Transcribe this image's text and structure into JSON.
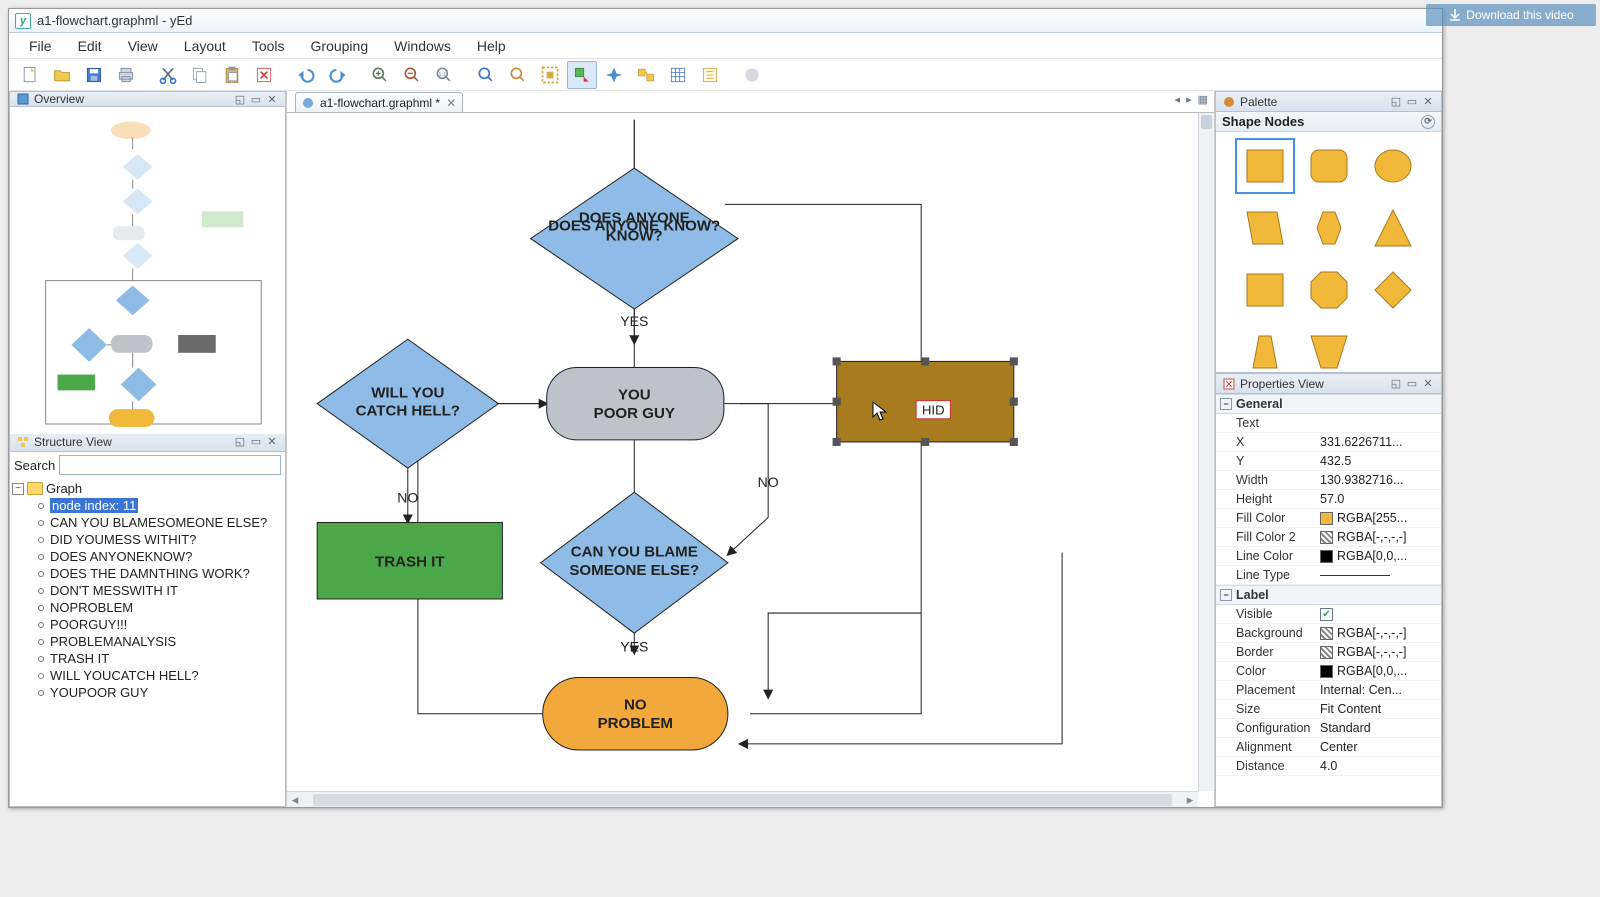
{
  "window": {
    "title": "a1-flowchart.graphml - yEd"
  },
  "download_label": "Download this video",
  "menus": [
    "File",
    "Edit",
    "View",
    "Layout",
    "Tools",
    "Grouping",
    "Windows",
    "Help"
  ],
  "toolbar_icons": [
    "new-file-icon",
    "open-file-icon",
    "save-icon",
    "print-icon",
    "cut-icon",
    "copy-icon",
    "paste-icon",
    "delete-icon",
    "undo-icon",
    "redo-icon",
    "zoom-in-icon",
    "zoom-out-icon",
    "fit-icon",
    "zoom-selection-icon",
    "zoom-area-icon",
    "fit-content-icon",
    "selection-mode-icon",
    "navigation-mode-icon",
    "magnifier-icon",
    "grid-icon",
    "snap-icon",
    "overview-icon"
  ],
  "panels": {
    "overview_title": "Overview",
    "structure_title": "Structure View",
    "palette_title": "Palette",
    "properties_title": "Properties View"
  },
  "doctab": {
    "label": "a1-flowchart.graphml *"
  },
  "flowchart": {
    "decision1": "DOES ANYONE KNOW?",
    "decision2_l1": "WILL YOU",
    "decision2_l2": "CATCH HELL?",
    "process_l1": "YOU",
    "process_l2": "POOR GUY",
    "decision3_l1": "CAN YOU BLAME",
    "decision3_l2": "SOMEONE ELSE?",
    "trash": "TRASH IT",
    "noproblem_l1": "NO",
    "noproblem_l2": "PROBLEM",
    "yes1": "YES",
    "yes2": "YES",
    "no1": "NO",
    "no2": "NO",
    "editing_text": "HID"
  },
  "structure": {
    "search_label": "Search",
    "root": "Graph",
    "selected": "node index: 11",
    "items": [
      "CAN YOU BLAMESOMEONE ELSE?",
      "DID YOUMESS WITHIT?",
      "DOES ANYONEKNOW?",
      "DOES THE DAMNTHING WORK?",
      "DON'T MESSWITH IT",
      "NOPROBLEM",
      "POORGUY!!!",
      "PROBLEMANALYSIS",
      "TRASH IT",
      "WILL YOUCATCH HELL?",
      "YOUPOOR GUY"
    ]
  },
  "palette": {
    "section": "Shape Nodes"
  },
  "properties": {
    "group_general": "General",
    "group_label": "Label",
    "rows": {
      "text_k": "Text",
      "text_v": "",
      "x_k": "X",
      "x_v": "331.6226711...",
      "y_k": "Y",
      "y_v": "432.5",
      "width_k": "Width",
      "width_v": "130.9382716...",
      "height_k": "Height",
      "height_v": "57.0",
      "fill_k": "Fill Color",
      "fill_v": "RGBA[255...",
      "fill2_k": "Fill Color 2",
      "fill2_v": "RGBA[-,-,-,-]",
      "linec_k": "Line Color",
      "linec_v": "RGBA[0,0,...",
      "linet_k": "Line Type",
      "vis_k": "Visible",
      "bg_k": "Background",
      "bg_v": "RGBA[-,-,-,-]",
      "border_k": "Border",
      "border_v": "RGBA[-,-,-,-]",
      "color_k": "Color",
      "color_v": "RGBA[0,0,...",
      "place_k": "Placement",
      "place_v": "Internal: Cen...",
      "size_k": "Size",
      "size_v": "Fit Content",
      "config_k": "Configuration",
      "config_v": "Standard",
      "align_k": "Alignment",
      "align_v": "Center",
      "dist_k": "Distance",
      "dist_v": "4.0"
    }
  }
}
